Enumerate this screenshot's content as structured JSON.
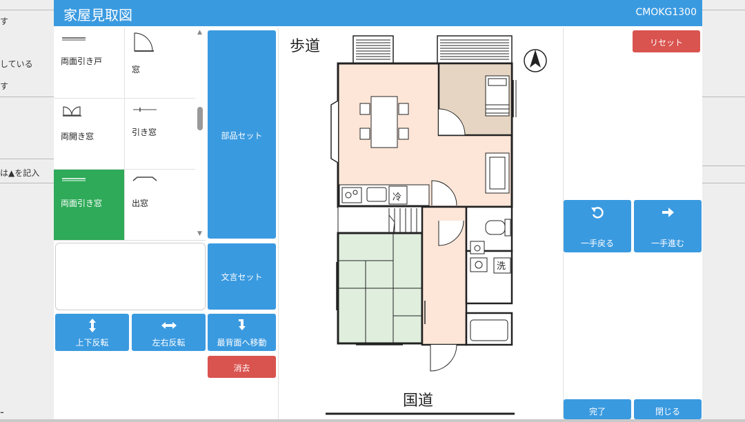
{
  "background": {
    "left_texts": [
      "す",
      "している",
      "す",
      "は▲を記入"
    ],
    "left_dash": "-"
  },
  "title": "家屋見取図",
  "screen_code": "CMOKG1300",
  "palette": {
    "items": [
      {
        "label": "両面引き戸",
        "icon": "double-sliding-door-icon",
        "selected": false
      },
      {
        "label": "窓",
        "icon": "window-swing-icon",
        "selected": false
      },
      {
        "label": "両開き窓",
        "icon": "double-casement-window-icon",
        "selected": false
      },
      {
        "label": "引き窓",
        "icon": "sliding-window-icon",
        "selected": false
      },
      {
        "label": "両面引き窓",
        "icon": "double-sliding-window-icon",
        "selected": true
      },
      {
        "label": "出窓",
        "icon": "bay-window-icon",
        "selected": false
      }
    ]
  },
  "buttons": {
    "parts_set": "部品セット",
    "text_set": "文言セット",
    "flip_vertical": "上下反転",
    "flip_horizontal": "左右反転",
    "send_to_back": "最背面へ移動",
    "delete": "消去",
    "reset": "リセット",
    "undo": "一手戻る",
    "redo": "一手進む",
    "done": "完了",
    "close": "閉じる"
  },
  "plan": {
    "sidewalk_label": "歩道",
    "road_label": "国道",
    "fridge_label": "冷",
    "washer_label": "洗"
  },
  "colors": {
    "header": "#3a9ae0",
    "button": "#3a9ae0",
    "danger": "#d9534f",
    "selected": "#2eaa58",
    "ldk_floor": "#fde6d8",
    "bedroom_floor": "#e6d5c3",
    "tatami": "#dfeedd"
  }
}
